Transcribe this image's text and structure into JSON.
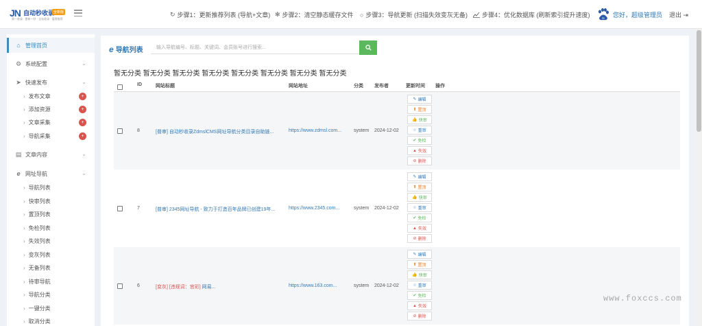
{
  "logo": {
    "mark": "JN",
    "text": "自动秒收录",
    "badge": "全新版",
    "sub": "第一收录 · 更新一秒 · 全站收录 · 值得推荐"
  },
  "steps": [
    {
      "icon": "refresh-icon",
      "glyph": "↻",
      "label": "步骤1：更新推荐列表 (导航+文章)"
    },
    {
      "icon": "spinner-icon",
      "glyph": "✻",
      "label": "步骤2：清空静态缓存文件"
    },
    {
      "icon": "circle-icon",
      "glyph": "○",
      "label": "步骤3：导航更新 (扫描失效变灰无备)"
    },
    {
      "icon": "line-chart-icon",
      "glyph": "📈",
      "label": "步骤4：优化数据库 (刷新索引提升速度)"
    }
  ],
  "user": {
    "greeting": "您好，超级管理员",
    "logout": "退出"
  },
  "sidebar": {
    "home": "管理首页",
    "config": "系统配置",
    "quick_publish": "快速发布",
    "quick_items": [
      {
        "label": "发布文章",
        "badge": "+"
      },
      {
        "label": "添加资源",
        "badge": "+"
      },
      {
        "label": "文章采集",
        "badge": "+"
      },
      {
        "label": "导航采集",
        "badge": "+"
      }
    ],
    "article": "文章内容",
    "nav": "网址导航",
    "nav_items": [
      "导航列表",
      "快审列表",
      "置顶列表",
      "免检列表",
      "失效列表",
      "变灰列表",
      "无备列表",
      "待审导航",
      "导航分类",
      "一键分类",
      "取消分类"
    ]
  },
  "panel": {
    "title": "导航列表",
    "search_placeholder": "输入导航编号、标题、关键词、会员账号进行搜索...",
    "category_line": "暂无分类 暂无分类 暂无分类 暂无分类 暂无分类 暂无分类 暂无分类 暂无分类"
  },
  "table": {
    "headers": {
      "id": "ID",
      "title": "网站标题",
      "url": "网站地址",
      "category": "分类",
      "publisher": "发布者",
      "updated": "更新时间",
      "action": "操作"
    },
    "actions": [
      "编辑",
      "置顶",
      "快审",
      "重审",
      "免检",
      "失效",
      "删除"
    ],
    "rows": [
      {
        "id": "8",
        "tag": "[普审]",
        "title": " 自动秒收录ZdmslCMS网址导航分类目录自助链...",
        "url": "https://www.zdmsl.com...",
        "category": "system",
        "publisher": "2024-12-02",
        "updated": ""
      },
      {
        "id": "7",
        "tag": "[普审]",
        "title": " 2345网址导航 - 致力于打造百年品牌已创建19年...",
        "url": "https://www.2345.com...",
        "category": "system",
        "publisher": "2024-12-02",
        "updated": ""
      },
      {
        "id": "6",
        "tag": "[变灰] [违规词：宫彩]",
        "title": " 网易...",
        "url": "https://www.163.com...",
        "category": "system",
        "publisher": "2024-12-02",
        "updated": ""
      }
    ]
  },
  "watermark": "www.foxccs.com",
  "colors": {
    "accent": "#3c8dbc",
    "link": "#337ab7",
    "search_button": "#5cb85c",
    "badge": "#d9534f"
  }
}
